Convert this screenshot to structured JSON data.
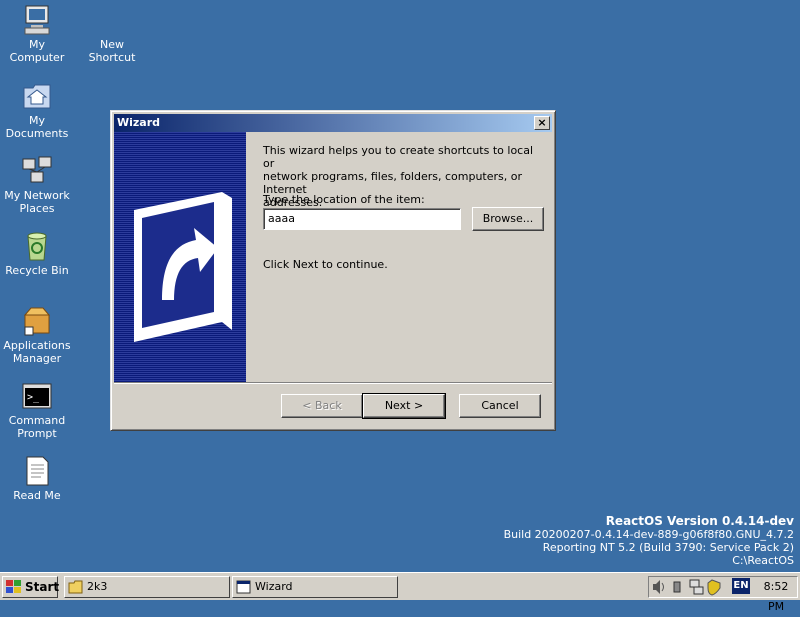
{
  "desktop": {
    "icons": [
      {
        "name": "my-computer",
        "label_1": "My",
        "label_2": "Computer"
      },
      {
        "name": "new-shortcut",
        "label_1": "New",
        "label_2": "Shortcut"
      },
      {
        "name": "my-documents",
        "label_1": "My",
        "label_2": "Documents"
      },
      {
        "name": "my-network-places",
        "label_1": "My Network",
        "label_2": "Places"
      },
      {
        "name": "recycle-bin",
        "label_1": "Recycle Bin",
        "label_2": ""
      },
      {
        "name": "applications-manager",
        "label_1": "Applications",
        "label_2": "Manager"
      },
      {
        "name": "command-prompt",
        "label_1": "Command",
        "label_2": "Prompt"
      },
      {
        "name": "read-me",
        "label_1": "Read Me",
        "label_2": ""
      }
    ]
  },
  "wizard": {
    "title": "Wizard",
    "close_label": "×",
    "intro_1": "This wizard helps you to create shortcuts to local or",
    "intro_2": "network programs, files, folders, computers, or Internet",
    "intro_3": "addresses.",
    "location_label": "Type the location of the item:",
    "location_value": "aaaa",
    "browse_label": "Browse...",
    "continue_text": "Click Next to continue.",
    "back_label": "< Back",
    "next_label": "Next >",
    "cancel_label": "Cancel"
  },
  "version": {
    "title": "ReactOS Version 0.4.14-dev",
    "build": "Build 20200207-0.4.14-dev-889-g06f8f80.GNU_4.7.2",
    "reporting": "Reporting NT 5.2 (Build 3790: Service Pack 2)",
    "path": "C:\\ReactOS"
  },
  "taskbar": {
    "start_label": "Start",
    "tasks": [
      {
        "label": "2k3"
      },
      {
        "label": "Wizard"
      }
    ],
    "language": "EN",
    "clock": "8:52 PM"
  },
  "colors": {
    "desktop": "#3a6ea5",
    "titlebar_start": "#0a246a",
    "titlebar_end": "#a6caf0",
    "face": "#d4d0c8"
  }
}
